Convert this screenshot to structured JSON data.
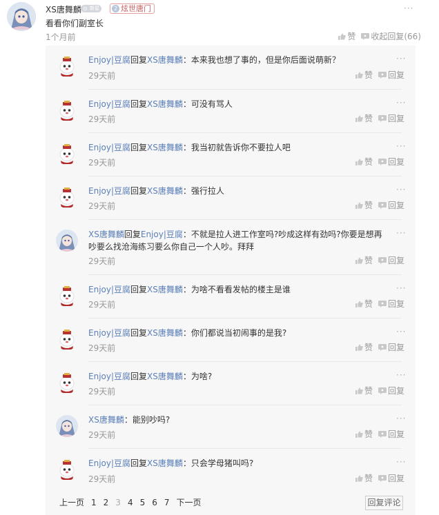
{
  "main_comment": {
    "username": "XS唐舞麟",
    "new_badge": "新星",
    "fan_badge_level": "2",
    "fan_badge_name": "炫世唐门",
    "text": "看看你们副室长",
    "time": "1个月前",
    "like_label": "赞",
    "reply_label": "收起回复(66)",
    "more_label": "···"
  },
  "replies": [
    {
      "avatar": "mascot-avatar",
      "from": "Enjoy|豆腐",
      "reply_word": "回复",
      "to": "XS唐舞麟",
      "sep": "：",
      "text": "本来我也想了事的，但是你后面说萌新？",
      "time": "29天前"
    },
    {
      "avatar": "mascot-avatar",
      "from": "Enjoy|豆腐",
      "reply_word": "回复",
      "to": "XS唐舞麟",
      "sep": "：",
      "text": "可没有骂人",
      "time": "29天前"
    },
    {
      "avatar": "mascot-avatar",
      "from": "Enjoy|豆腐",
      "reply_word": "回复",
      "to": "XS唐舞麟",
      "sep": "：",
      "text": "我当初就告诉你不要拉人吧",
      "time": "29天前"
    },
    {
      "avatar": "mascot-avatar",
      "from": "Enjoy|豆腐",
      "reply_word": "回复",
      "to": "XS唐舞麟",
      "sep": "：",
      "text": "强行拉人",
      "time": "29天前"
    },
    {
      "avatar": "anime-avatar",
      "from": "XS唐舞麟",
      "reply_word": "回复",
      "to": "Enjoy|豆腐",
      "sep": "：",
      "text": "不就是拉人进工作室吗?吵成这样有劲吗?你要是想再吵要么找沧海练习要么你自己一个人吵。拜拜",
      "time": "29天前"
    },
    {
      "avatar": "mascot-avatar",
      "from": "Enjoy|豆腐",
      "reply_word": "回复",
      "to": "XS唐舞麟",
      "sep": "：",
      "text": "为啥不看看发帖的楼主是谁",
      "time": "29天前"
    },
    {
      "avatar": "mascot-avatar",
      "from": "Enjoy|豆腐",
      "reply_word": "回复",
      "to": "XS唐舞麟",
      "sep": "：",
      "text": "你们都说当初闹事的是我?",
      "time": "29天前"
    },
    {
      "avatar": "mascot-avatar",
      "from": "Enjoy|豆腐",
      "reply_word": "回复",
      "to": "XS唐舞麟",
      "sep": "：",
      "text": "为啥?",
      "time": "29天前"
    },
    {
      "avatar": "anime-avatar",
      "from": "XS唐舞麟",
      "reply_word": "",
      "to": "",
      "sep": "：",
      "text": "能别吵吗?",
      "time": "29天前"
    },
    {
      "avatar": "mascot-avatar",
      "from": "Enjoy|豆腐",
      "reply_word": "回复",
      "to": "XS唐舞麟",
      "sep": "：",
      "text": "只会学母猪叫吗?",
      "time": "29天前"
    }
  ],
  "reply_actions": {
    "like_label": "赞",
    "reply_label": "回复",
    "more_label": "···"
  },
  "pagination": {
    "prev": "上一页",
    "pages": [
      "1",
      "2",
      "3",
      "4",
      "5",
      "6",
      "7"
    ],
    "current": "3",
    "next": "下一页",
    "reply_comment": "回复评论"
  },
  "colors": {
    "link": "#5b7fb8",
    "muted": "#999999",
    "reply_bg": "#f7f7f7"
  }
}
